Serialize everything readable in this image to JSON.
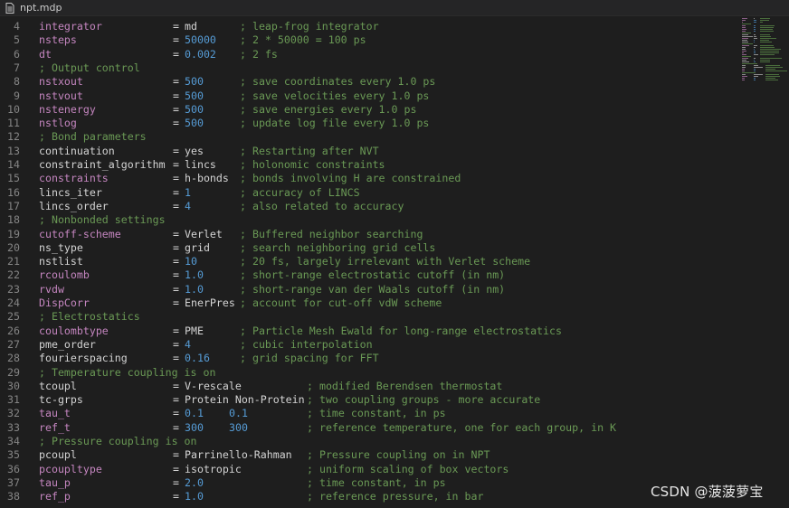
{
  "tab": {
    "filename": "npt.mdp",
    "icon": "file-lines-icon"
  },
  "colors": {
    "background": "#1e1e1e",
    "keyword": "#c586c0",
    "plain": "#d4d4d4",
    "comment": "#6a9955",
    "number": "#569cd6",
    "line_number": "#858585"
  },
  "lines": [
    {
      "n": "4",
      "key": "integrator",
      "keyStyle": "key",
      "eq": "=",
      "val": "md",
      "valStyle": "plain",
      "cmt": "; leap-frog integrator",
      "cmtCol": 1
    },
    {
      "n": "5",
      "key": "nsteps",
      "keyStyle": "key",
      "eq": "=",
      "val": "50000",
      "valStyle": "num",
      "cmt": "; 2 * 50000 = 100 ps",
      "cmtCol": 1
    },
    {
      "n": "6",
      "key": "dt",
      "keyStyle": "key",
      "eq": "=",
      "val": "0.002",
      "valStyle": "num",
      "cmt": "; 2 fs",
      "cmtCol": 1
    },
    {
      "n": "7",
      "section": "; Output control"
    },
    {
      "n": "8",
      "key": "nstxout",
      "keyStyle": "key",
      "eq": "=",
      "val": "500",
      "valStyle": "num",
      "cmt": "; save coordinates every 1.0 ps",
      "cmtCol": 1
    },
    {
      "n": "9",
      "key": "nstvout",
      "keyStyle": "key",
      "eq": "=",
      "val": "500",
      "valStyle": "num",
      "cmt": "; save velocities every 1.0 ps",
      "cmtCol": 1
    },
    {
      "n": "10",
      "key": "nstenergy",
      "keyStyle": "key",
      "eq": "=",
      "val": "500",
      "valStyle": "num",
      "cmt": "; save energies every 1.0 ps",
      "cmtCol": 1
    },
    {
      "n": "11",
      "key": "nstlog",
      "keyStyle": "key",
      "eq": "=",
      "val": "500",
      "valStyle": "num",
      "cmt": "; update log file every 1.0 ps",
      "cmtCol": 1
    },
    {
      "n": "12",
      "section": "; Bond parameters"
    },
    {
      "n": "13",
      "key": "continuation",
      "keyStyle": "plain",
      "eq": "=",
      "val": "yes",
      "valStyle": "plain",
      "cmt": "; Restarting after NVT",
      "cmtCol": 1
    },
    {
      "n": "14",
      "key": "constraint_algorithm",
      "keyStyle": "plain",
      "eq": "=",
      "val": "lincs",
      "valStyle": "plain",
      "cmt": "; holonomic constraints",
      "cmtCol": 1
    },
    {
      "n": "15",
      "key": "constraints",
      "keyStyle": "key",
      "eq": "=",
      "val": "h-bonds",
      "valStyle": "plain",
      "cmt": "; bonds involving H are constrained",
      "cmtCol": 1
    },
    {
      "n": "16",
      "key": "lincs_iter",
      "keyStyle": "plain",
      "eq": "=",
      "val": "1",
      "valStyle": "num",
      "cmt": "; accuracy of LINCS",
      "cmtCol": 1
    },
    {
      "n": "17",
      "key": "lincs_order",
      "keyStyle": "plain",
      "eq": "=",
      "val": "4",
      "valStyle": "num",
      "cmt": "; also related to accuracy",
      "cmtCol": 1
    },
    {
      "n": "18",
      "section": "; Nonbonded settings"
    },
    {
      "n": "19",
      "key": "cutoff-scheme",
      "keyStyle": "key",
      "eq": "=",
      "val": "Verlet",
      "valStyle": "plain",
      "cmt": "; Buffered neighbor searching",
      "cmtCol": 1
    },
    {
      "n": "20",
      "key": "ns_type",
      "keyStyle": "plain",
      "eq": "=",
      "val": "grid",
      "valStyle": "plain",
      "cmt": "; search neighboring grid cells",
      "cmtCol": 1
    },
    {
      "n": "21",
      "key": "nstlist",
      "keyStyle": "plain",
      "eq": "=",
      "val": "10",
      "valStyle": "num",
      "cmt": "; 20 fs, largely irrelevant with Verlet scheme",
      "cmtCol": 1
    },
    {
      "n": "22",
      "key": "rcoulomb",
      "keyStyle": "key",
      "eq": "=",
      "val": "1.0",
      "valStyle": "num",
      "cmt": "; short-range electrostatic cutoff (in nm)",
      "cmtCol": 1
    },
    {
      "n": "23",
      "key": "rvdw",
      "keyStyle": "key",
      "eq": "=",
      "val": "1.0",
      "valStyle": "num",
      "cmt": "; short-range van der Waals cutoff (in nm)",
      "cmtCol": 1
    },
    {
      "n": "24",
      "key": "DispCorr",
      "keyStyle": "key",
      "eq": "=",
      "val": "EnerPres",
      "valStyle": "plain",
      "cmt": "; account for cut-off vdW scheme",
      "cmtCol": 1
    },
    {
      "n": "25",
      "section": "; Electrostatics"
    },
    {
      "n": "26",
      "key": "coulombtype",
      "keyStyle": "key",
      "eq": "=",
      "val": "PME",
      "valStyle": "plain",
      "cmt": "; Particle Mesh Ewald for long-range electrostatics",
      "cmtCol": 1
    },
    {
      "n": "27",
      "key": "pme_order",
      "keyStyle": "plain",
      "eq": "=",
      "val": "4",
      "valStyle": "num",
      "cmt": "; cubic interpolation",
      "cmtCol": 1
    },
    {
      "n": "28",
      "key": "fourierspacing",
      "keyStyle": "plain",
      "eq": "=",
      "val": "0.16",
      "valStyle": "num",
      "cmt": "; grid spacing for FFT",
      "cmtCol": 1
    },
    {
      "n": "29",
      "section": "; Temperature coupling is on"
    },
    {
      "n": "30",
      "key": "tcoupl",
      "keyStyle": "plain",
      "eq": "=",
      "val": "V-rescale",
      "valStyle": "plain",
      "cmt": "; modified Berendsen thermostat",
      "cmtCol": 2
    },
    {
      "n": "31",
      "key": "tc-grps",
      "keyStyle": "plain",
      "eq": "=",
      "val": "Protein Non-Protein",
      "valStyle": "plain",
      "cmt": "; two coupling groups - more accurate",
      "cmtCol": 2
    },
    {
      "n": "32",
      "key": "tau_t",
      "keyStyle": "key",
      "eq": "=",
      "val": "0.1",
      "val2": "0.1",
      "valStyle": "num",
      "cmt": "; time constant, in ps",
      "cmtCol": 2
    },
    {
      "n": "33",
      "key": "ref_t",
      "keyStyle": "key",
      "eq": "=",
      "val": "300",
      "val2": "300",
      "valStyle": "num",
      "cmt": "; reference temperature, one for each group, in K",
      "cmtCol": 2
    },
    {
      "n": "34",
      "section": "; Pressure coupling is on"
    },
    {
      "n": "35",
      "key": "pcoupl",
      "keyStyle": "plain",
      "eq": "=",
      "val": "Parrinello-Rahman",
      "valStyle": "plain",
      "cmt": "; Pressure coupling on in NPT",
      "cmtCol": 2
    },
    {
      "n": "36",
      "key": "pcoupltype",
      "keyStyle": "key",
      "eq": "=",
      "val": "isotropic",
      "valStyle": "plain",
      "cmt": "; uniform scaling of box vectors",
      "cmtCol": 2
    },
    {
      "n": "37",
      "key": "tau_p",
      "keyStyle": "key",
      "eq": "=",
      "val": "2.0",
      "valStyle": "num",
      "cmt": "; time constant, in ps",
      "cmtCol": 2
    },
    {
      "n": "38",
      "key": "ref_p",
      "keyStyle": "key",
      "eq": "=",
      "val": "1.0",
      "valStyle": "num",
      "cmt": "; reference pressure, in bar",
      "cmtCol": 2
    }
  ],
  "watermark": "CSDN @菠菠萝宝"
}
